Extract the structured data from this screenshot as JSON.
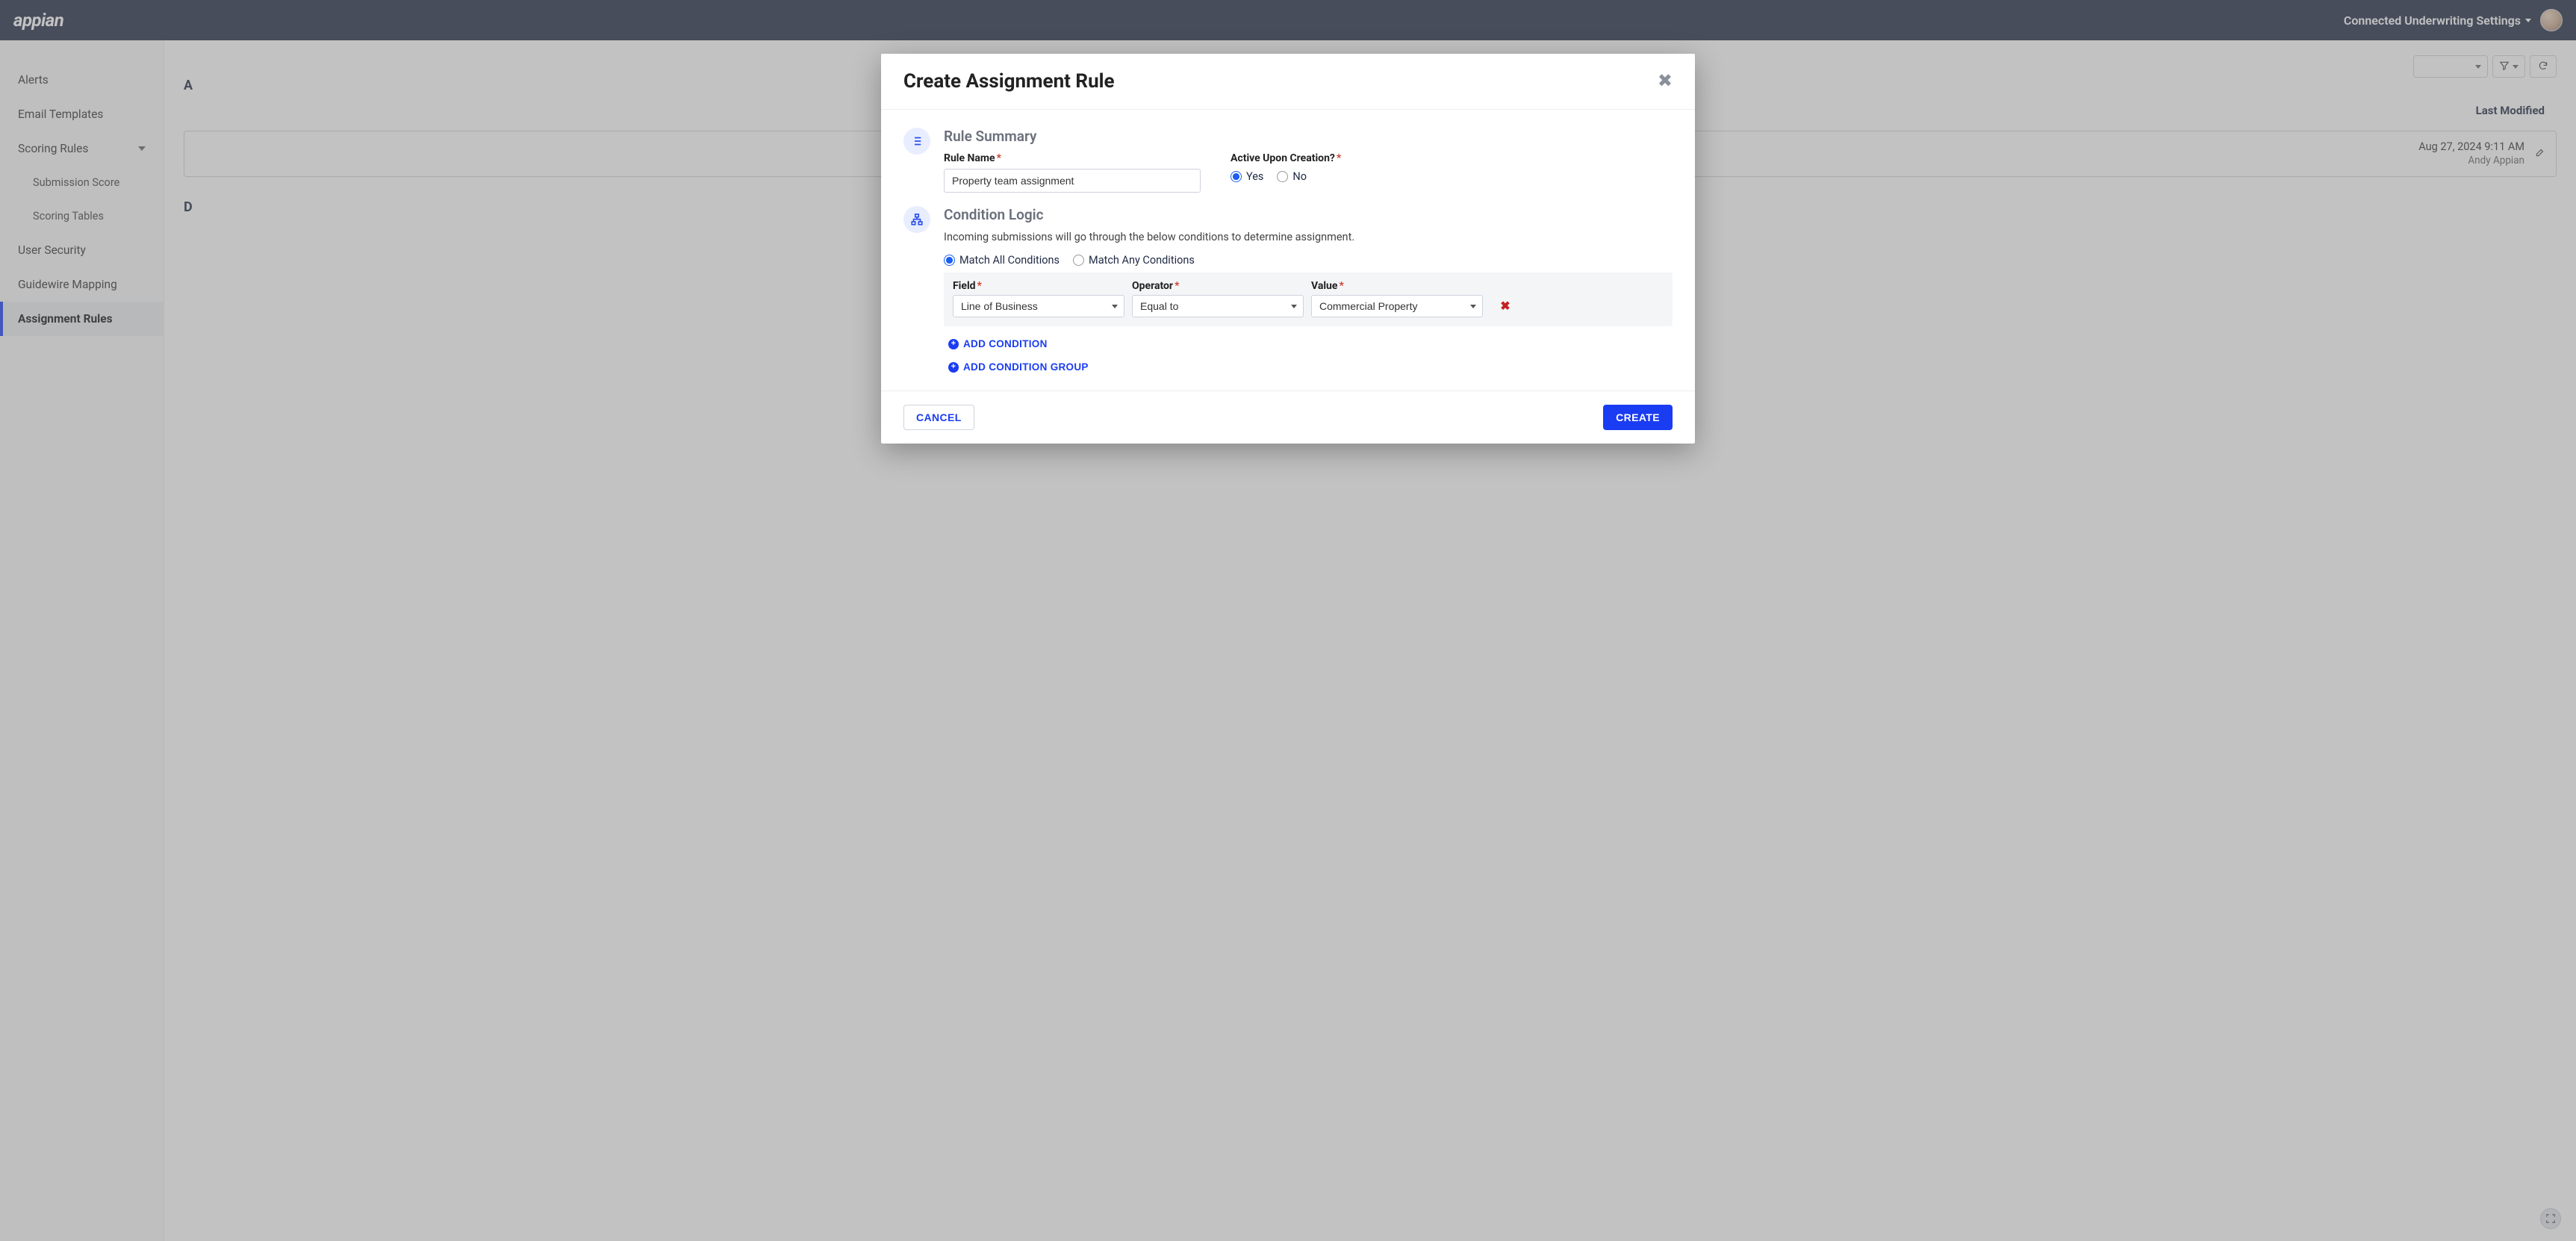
{
  "topbar": {
    "brand": "appian",
    "menu_label": "Connected Underwriting Settings"
  },
  "sidebar": {
    "items": [
      {
        "label": "Alerts"
      },
      {
        "label": "Email Templates"
      },
      {
        "label": "Scoring Rules",
        "expanded": true
      },
      {
        "label": "User Security"
      },
      {
        "label": "Guidewire Mapping"
      },
      {
        "label": "Assignment Rules",
        "active": true
      }
    ],
    "scoring_children": [
      {
        "label": "Submission Score"
      },
      {
        "label": "Scoring Tables"
      }
    ]
  },
  "content": {
    "heading_a_letter": "A",
    "heading_d_letter": "D",
    "last_modified_header": "Last Modified",
    "card": {
      "when": "Aug 27, 2024 9:11 AM",
      "who": "Andy Appian"
    }
  },
  "modal": {
    "title": "Create Assignment Rule",
    "summary": {
      "heading": "Rule Summary",
      "name_label": "Rule Name",
      "name_value": "Property team assignment",
      "active_label": "Active Upon Creation?",
      "active_options": {
        "yes": "Yes",
        "no": "No"
      },
      "active_selected": "yes"
    },
    "logic": {
      "heading": "Condition Logic",
      "description": "Incoming submissions will go through the below conditions to determine assignment.",
      "match_options": {
        "all": "Match All Conditions",
        "any": "Match Any Conditions"
      },
      "match_selected": "all",
      "headers": {
        "field": "Field",
        "operator": "Operator",
        "value": "Value"
      },
      "conditions": [
        {
          "field": "Line of Business",
          "operator": "Equal to",
          "value": "Commercial Property"
        }
      ],
      "add_condition_label": "ADD CONDITION",
      "add_group_label": "ADD CONDITION GROUP"
    },
    "footer": {
      "cancel": "CANCEL",
      "create": "CREATE"
    }
  }
}
